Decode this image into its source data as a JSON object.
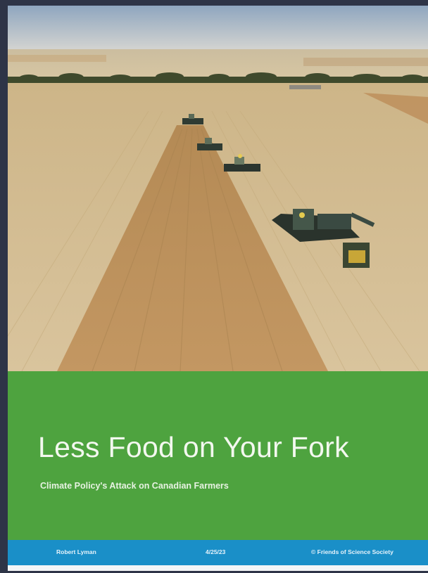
{
  "cover": {
    "photo_icon": "wheat-field-harvest-photo",
    "title": "Less Food on Your Fork",
    "subtitle": "Climate Policy's Attack on Canadian Farmers"
  },
  "footer": {
    "author": "Robert Lyman",
    "date": "4/25/23",
    "organization": "© Friends of Science Society"
  },
  "colors": {
    "panel_green": "#4ea33f",
    "footer_blue": "#1a8fc8",
    "frame_dark": "#2e3447"
  }
}
